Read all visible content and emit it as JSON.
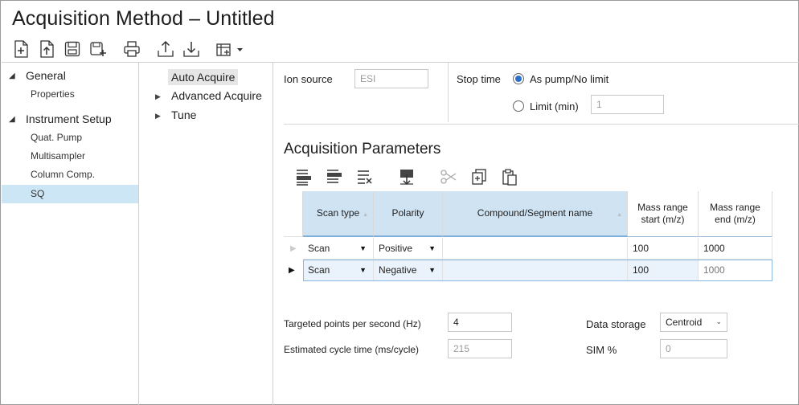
{
  "window": {
    "title": "Acquisition Method – Untitled"
  },
  "toolbar": {
    "buttons": [
      "new-icon",
      "open-icon",
      "save-icon",
      "save-as-icon",
      "print-icon",
      "export-icon",
      "import-icon",
      "layout-icon"
    ]
  },
  "tree": {
    "groups": [
      {
        "label": "General",
        "children": [
          "Properties"
        ]
      },
      {
        "label": "Instrument Setup",
        "children": [
          "Quat. Pump",
          "Multisampler",
          "Column Comp.",
          "SQ"
        ]
      }
    ],
    "selected": "SQ"
  },
  "nav": {
    "items": [
      {
        "label": "Auto Acquire",
        "expandable": false,
        "active": true
      },
      {
        "label": "Advanced Acquire",
        "expandable": true,
        "active": false
      },
      {
        "label": "Tune",
        "expandable": true,
        "active": false
      }
    ]
  },
  "ion_source": {
    "label": "Ion source",
    "value": "ESI"
  },
  "stop_time": {
    "label": "Stop time",
    "option1": "As pump/No limit",
    "option2": "Limit (min)",
    "selected": "option1",
    "limit_value": "1"
  },
  "acquisition": {
    "title": "Acquisition Parameters",
    "columns": [
      "Scan type",
      "Polarity",
      "Compound/Segment name",
      "Mass range start (m/z)",
      "Mass range end (m/z)"
    ],
    "rows": [
      {
        "scan_type": "Scan",
        "polarity": "Positive",
        "name": "",
        "start": "100",
        "end": "1000"
      },
      {
        "scan_type": "Scan",
        "polarity": "Negative",
        "name": "",
        "start": "100",
        "end": "1000"
      }
    ]
  },
  "settings": {
    "tpps_label": "Targeted points per second (Hz)",
    "tpps_value": "4",
    "cycle_label": "Estimated cycle time (ms/cycle)",
    "cycle_value": "215",
    "storage_label": "Data storage",
    "storage_value": "Centroid",
    "sim_label": "SIM %",
    "sim_value": "0"
  },
  "colors": {
    "accent": "#2a6fc9",
    "selection": "#cde6f5",
    "header_blue": "#cfe3f3"
  }
}
